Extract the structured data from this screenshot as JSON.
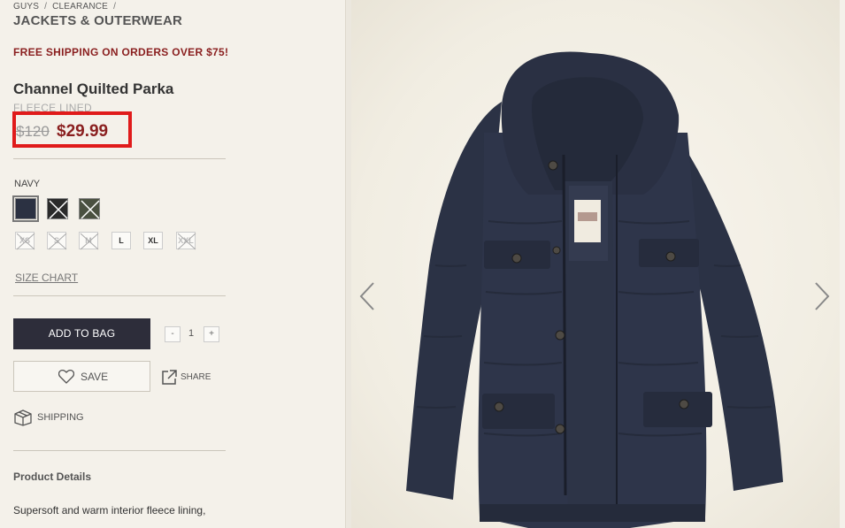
{
  "breadcrumb": {
    "items": [
      "GUYS",
      "CLEARANCE"
    ],
    "current": "JACKETS & OUTERWEAR"
  },
  "promo": "FREE SHIPPING ON ORDERS OVER $75!",
  "product": {
    "name": "Channel Quilted Parka",
    "subtitle": "FLEECE LINED",
    "old_price": "$120",
    "new_price": "$29.99"
  },
  "colors": {
    "selected_label": "NAVY",
    "swatches": [
      {
        "name": "navy",
        "hex": "#2b3142",
        "available": true,
        "selected": true
      },
      {
        "name": "black",
        "hex": "#2a2a2a",
        "available": false
      },
      {
        "name": "olive",
        "hex": "#4a5040",
        "available": false
      }
    ]
  },
  "sizes": [
    {
      "label": "XS",
      "available": false
    },
    {
      "label": "S",
      "available": false
    },
    {
      "label": "M",
      "available": false
    },
    {
      "label": "L",
      "available": true
    },
    {
      "label": "XL",
      "available": true
    },
    {
      "label": "XXL",
      "available": false
    }
  ],
  "size_chart_label": "SIZE CHART",
  "actions": {
    "add_to_bag": "ADD TO BAG",
    "qty_minus": "-",
    "qty_value": "1",
    "qty_plus": "+",
    "save": "SAVE",
    "share": "SHARE",
    "shipping": "SHIPPING"
  },
  "details": {
    "title": "Product Details",
    "text": "Supersoft and warm interior fleece lining,"
  },
  "colors_theme": {
    "accent_red": "#8a1f1f",
    "highlight_box": "#e01b1b",
    "button_dark": "#2d2d3a",
    "background": "#f4f1ea"
  }
}
